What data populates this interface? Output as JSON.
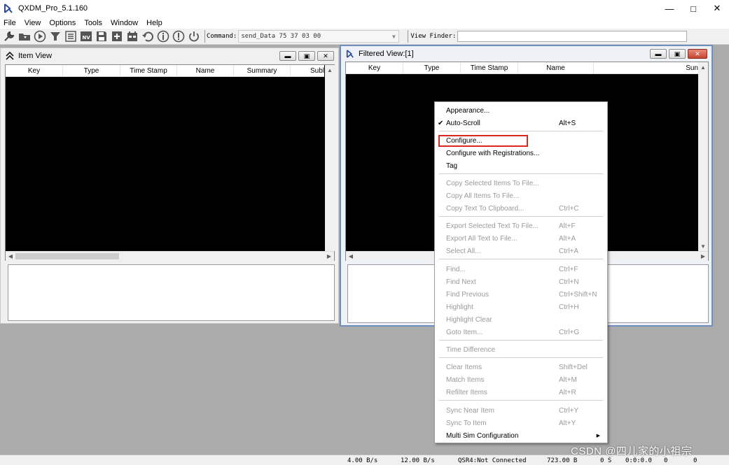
{
  "window": {
    "title": "QXDM_Pro_5.1.160",
    "minimize_glyph": "—",
    "maximize_glyph": "□",
    "close_glyph": "✕"
  },
  "menubar": {
    "items": [
      "File",
      "View",
      "Options",
      "Tools",
      "Window",
      "Help"
    ]
  },
  "toolbar": {
    "icons": [
      "tools-icon",
      "open-folder-icon",
      "play-icon",
      "filter-icon",
      "list-icon",
      "nv-icon",
      "save-icon",
      "add-icon",
      "calendar-icon",
      "undo-icon",
      "info-icon",
      "info-alt-icon",
      "power-icon"
    ],
    "nv_text": "NV",
    "command_label": "Command:",
    "command_value": "send_Data 75 37 03 00",
    "view_finder_label": "View Finder:",
    "view_finder_value": ""
  },
  "item_view": {
    "title": "Item View",
    "columns": [
      "Key",
      "Type",
      "Time Stamp",
      "Name",
      "Summary",
      "Subl"
    ]
  },
  "filtered_view": {
    "title": "Filtered View:[1]",
    "columns": [
      "Key",
      "Type",
      "Time Stamp",
      "Name",
      "Sun"
    ]
  },
  "context_menu": {
    "groups": [
      [
        {
          "label": "Appearance...",
          "shortcut": "",
          "enabled": true
        },
        {
          "label": "Auto-Scroll",
          "shortcut": "Alt+S",
          "enabled": true,
          "checked": true
        }
      ],
      [
        {
          "label": "Configure...",
          "shortcut": "",
          "enabled": true,
          "highlighted": true
        },
        {
          "label": "Configure with Registrations...",
          "shortcut": "",
          "enabled": true
        },
        {
          "label": "Tag",
          "shortcut": "",
          "enabled": true
        }
      ],
      [
        {
          "label": "Copy Selected Items To File...",
          "shortcut": "",
          "enabled": false
        },
        {
          "label": "Copy All Items To File...",
          "shortcut": "",
          "enabled": false
        },
        {
          "label": "Copy Text To Clipboard...",
          "shortcut": "Ctrl+C",
          "enabled": false
        }
      ],
      [
        {
          "label": "Export Selected Text To File...",
          "shortcut": "Alt+F",
          "enabled": false
        },
        {
          "label": "Export All Text to File...",
          "shortcut": "Alt+A",
          "enabled": false
        },
        {
          "label": "Select All...",
          "shortcut": "Ctrl+A",
          "enabled": false
        }
      ],
      [
        {
          "label": "Find...",
          "shortcut": "Ctrl+F",
          "enabled": false
        },
        {
          "label": "Find Next",
          "shortcut": "Ctrl+N",
          "enabled": false
        },
        {
          "label": "Find Previous",
          "shortcut": "Ctrl+Shift+N",
          "enabled": false
        },
        {
          "label": "Highlight",
          "shortcut": "Ctrl+H",
          "enabled": false
        },
        {
          "label": "Highlight Clear",
          "shortcut": "",
          "enabled": false
        },
        {
          "label": "Goto Item...",
          "shortcut": "Ctrl+G",
          "enabled": false
        }
      ],
      [
        {
          "label": "Time Difference",
          "shortcut": "",
          "enabled": false
        }
      ],
      [
        {
          "label": "Clear Items",
          "shortcut": "Shift+Del",
          "enabled": false
        },
        {
          "label": "Match Items",
          "shortcut": "Alt+M",
          "enabled": false
        },
        {
          "label": "Refilter Items",
          "shortcut": "Alt+R",
          "enabled": false
        }
      ],
      [
        {
          "label": "Sync Near Item",
          "shortcut": "Ctrl+Y",
          "enabled": false
        },
        {
          "label": "Sync To Item",
          "shortcut": "Alt+Y",
          "enabled": false
        },
        {
          "label": "Multi Sim Configuration",
          "shortcut": "",
          "enabled": true,
          "submenu": true
        }
      ]
    ]
  },
  "statusbar": {
    "fields": [
      "4.00 B/s",
      "12.00 B/s",
      "QSR4:Not Connected",
      "723.00 B",
      "0 S",
      "0:0:0.0",
      "0",
      "0"
    ]
  },
  "watermark": "CSDN @四儿家的小祖宗",
  "colors": {
    "mdi_background": "#ababab",
    "list_background": "#000000",
    "highlight_border": "#d9281f",
    "disabled_text": "#9a9a9a"
  }
}
